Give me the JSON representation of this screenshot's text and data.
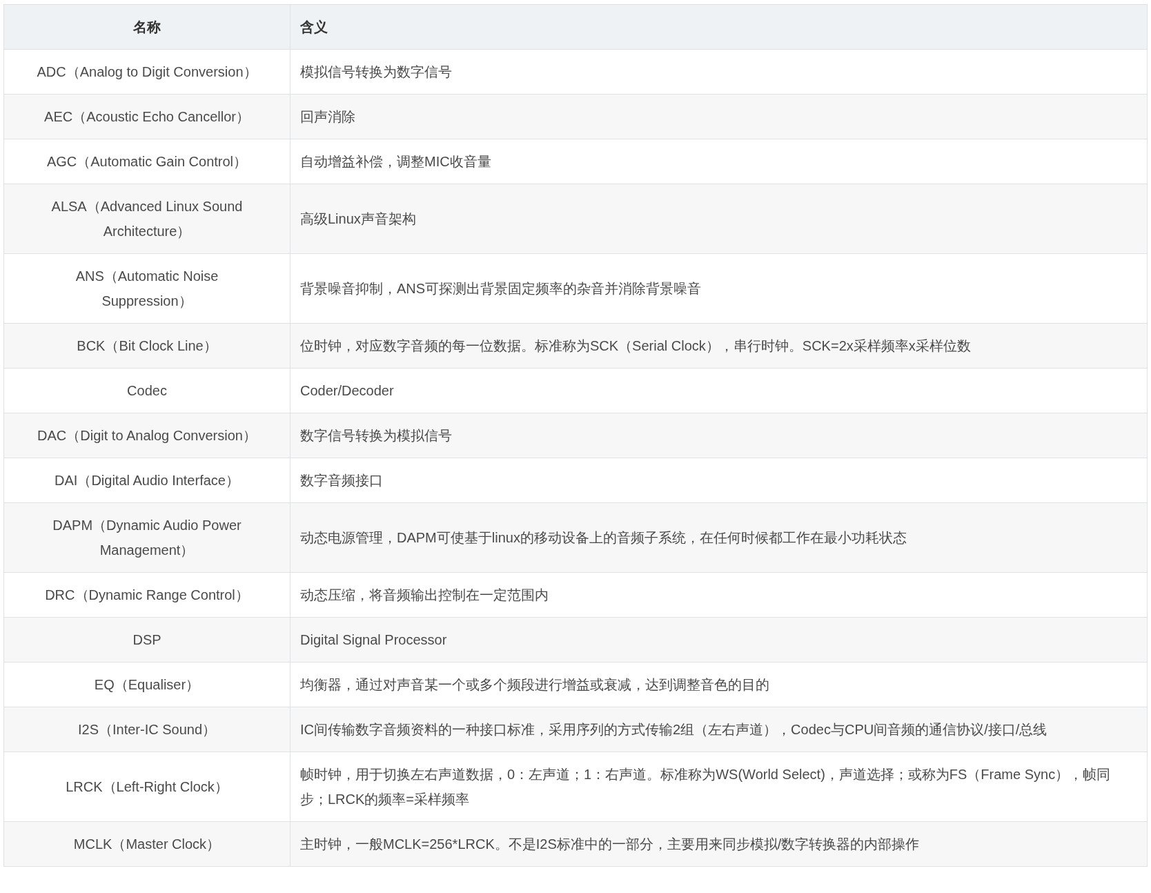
{
  "table": {
    "columns": [
      "名称",
      "含义"
    ],
    "rows": [
      [
        "ADC（Analog to Digit Conversion）",
        "模拟信号转换为数字信号"
      ],
      [
        "AEC（Acoustic Echo Cancellor）",
        "回声消除"
      ],
      [
        "AGC（Automatic Gain Control）",
        "自动增益补偿，调整MIC收音量"
      ],
      [
        "ALSA（Advanced Linux Sound Architecture）",
        "高级Linux声音架构"
      ],
      [
        "ANS（Automatic Noise Suppression）",
        "背景噪音抑制，ANS可探测出背景固定频率的杂音并消除背景噪音"
      ],
      [
        "BCK（Bit Clock Line）",
        "位时钟，对应数字音频的每一位数据。标准称为SCK（Serial Clock），串行时钟。SCK=2x采样频率x采样位数"
      ],
      [
        "Codec",
        "Coder/Decoder"
      ],
      [
        "DAC（Digit to Analog Conversion）",
        "数字信号转换为模拟信号"
      ],
      [
        "DAI（Digital Audio Interface）",
        "数字音频接口"
      ],
      [
        "DAPM（Dynamic Audio Power Management）",
        "动态电源管理，DAPM可使基于linux的移动设备上的音频子系统，在任何时候都工作在最小功耗状态"
      ],
      [
        "DRC（Dynamic Range Control）",
        "动态压缩，将音频输出控制在一定范围内"
      ],
      [
        "DSP",
        "Digital Signal Processor"
      ],
      [
        "EQ（Equaliser）",
        "均衡器，通过对声音某一个或多个频段进行增益或衰减，达到调整音色的目的"
      ],
      [
        "I2S（Inter-IC Sound）",
        "IC间传输数字音频资料的一种接口标准，采用序列的方式传输2组（左右声道），Codec与CPU间音频的通信协议/接口/总线"
      ],
      [
        "LRCK（Left-Right Clock）",
        "帧时钟，用于切换左右声道数据，0：左声道；1：右声道。标准称为WS(World Select)，声道选择；或称为FS（Frame Sync），帧同步；LRCK的频率=采样频率"
      ],
      [
        "MCLK（Master Clock）",
        "主时钟，一般MCLK=256*LRCK。不是I2S标准中的一部分，主要用来同步模拟/数字转换器的内部操作"
      ]
    ]
  }
}
